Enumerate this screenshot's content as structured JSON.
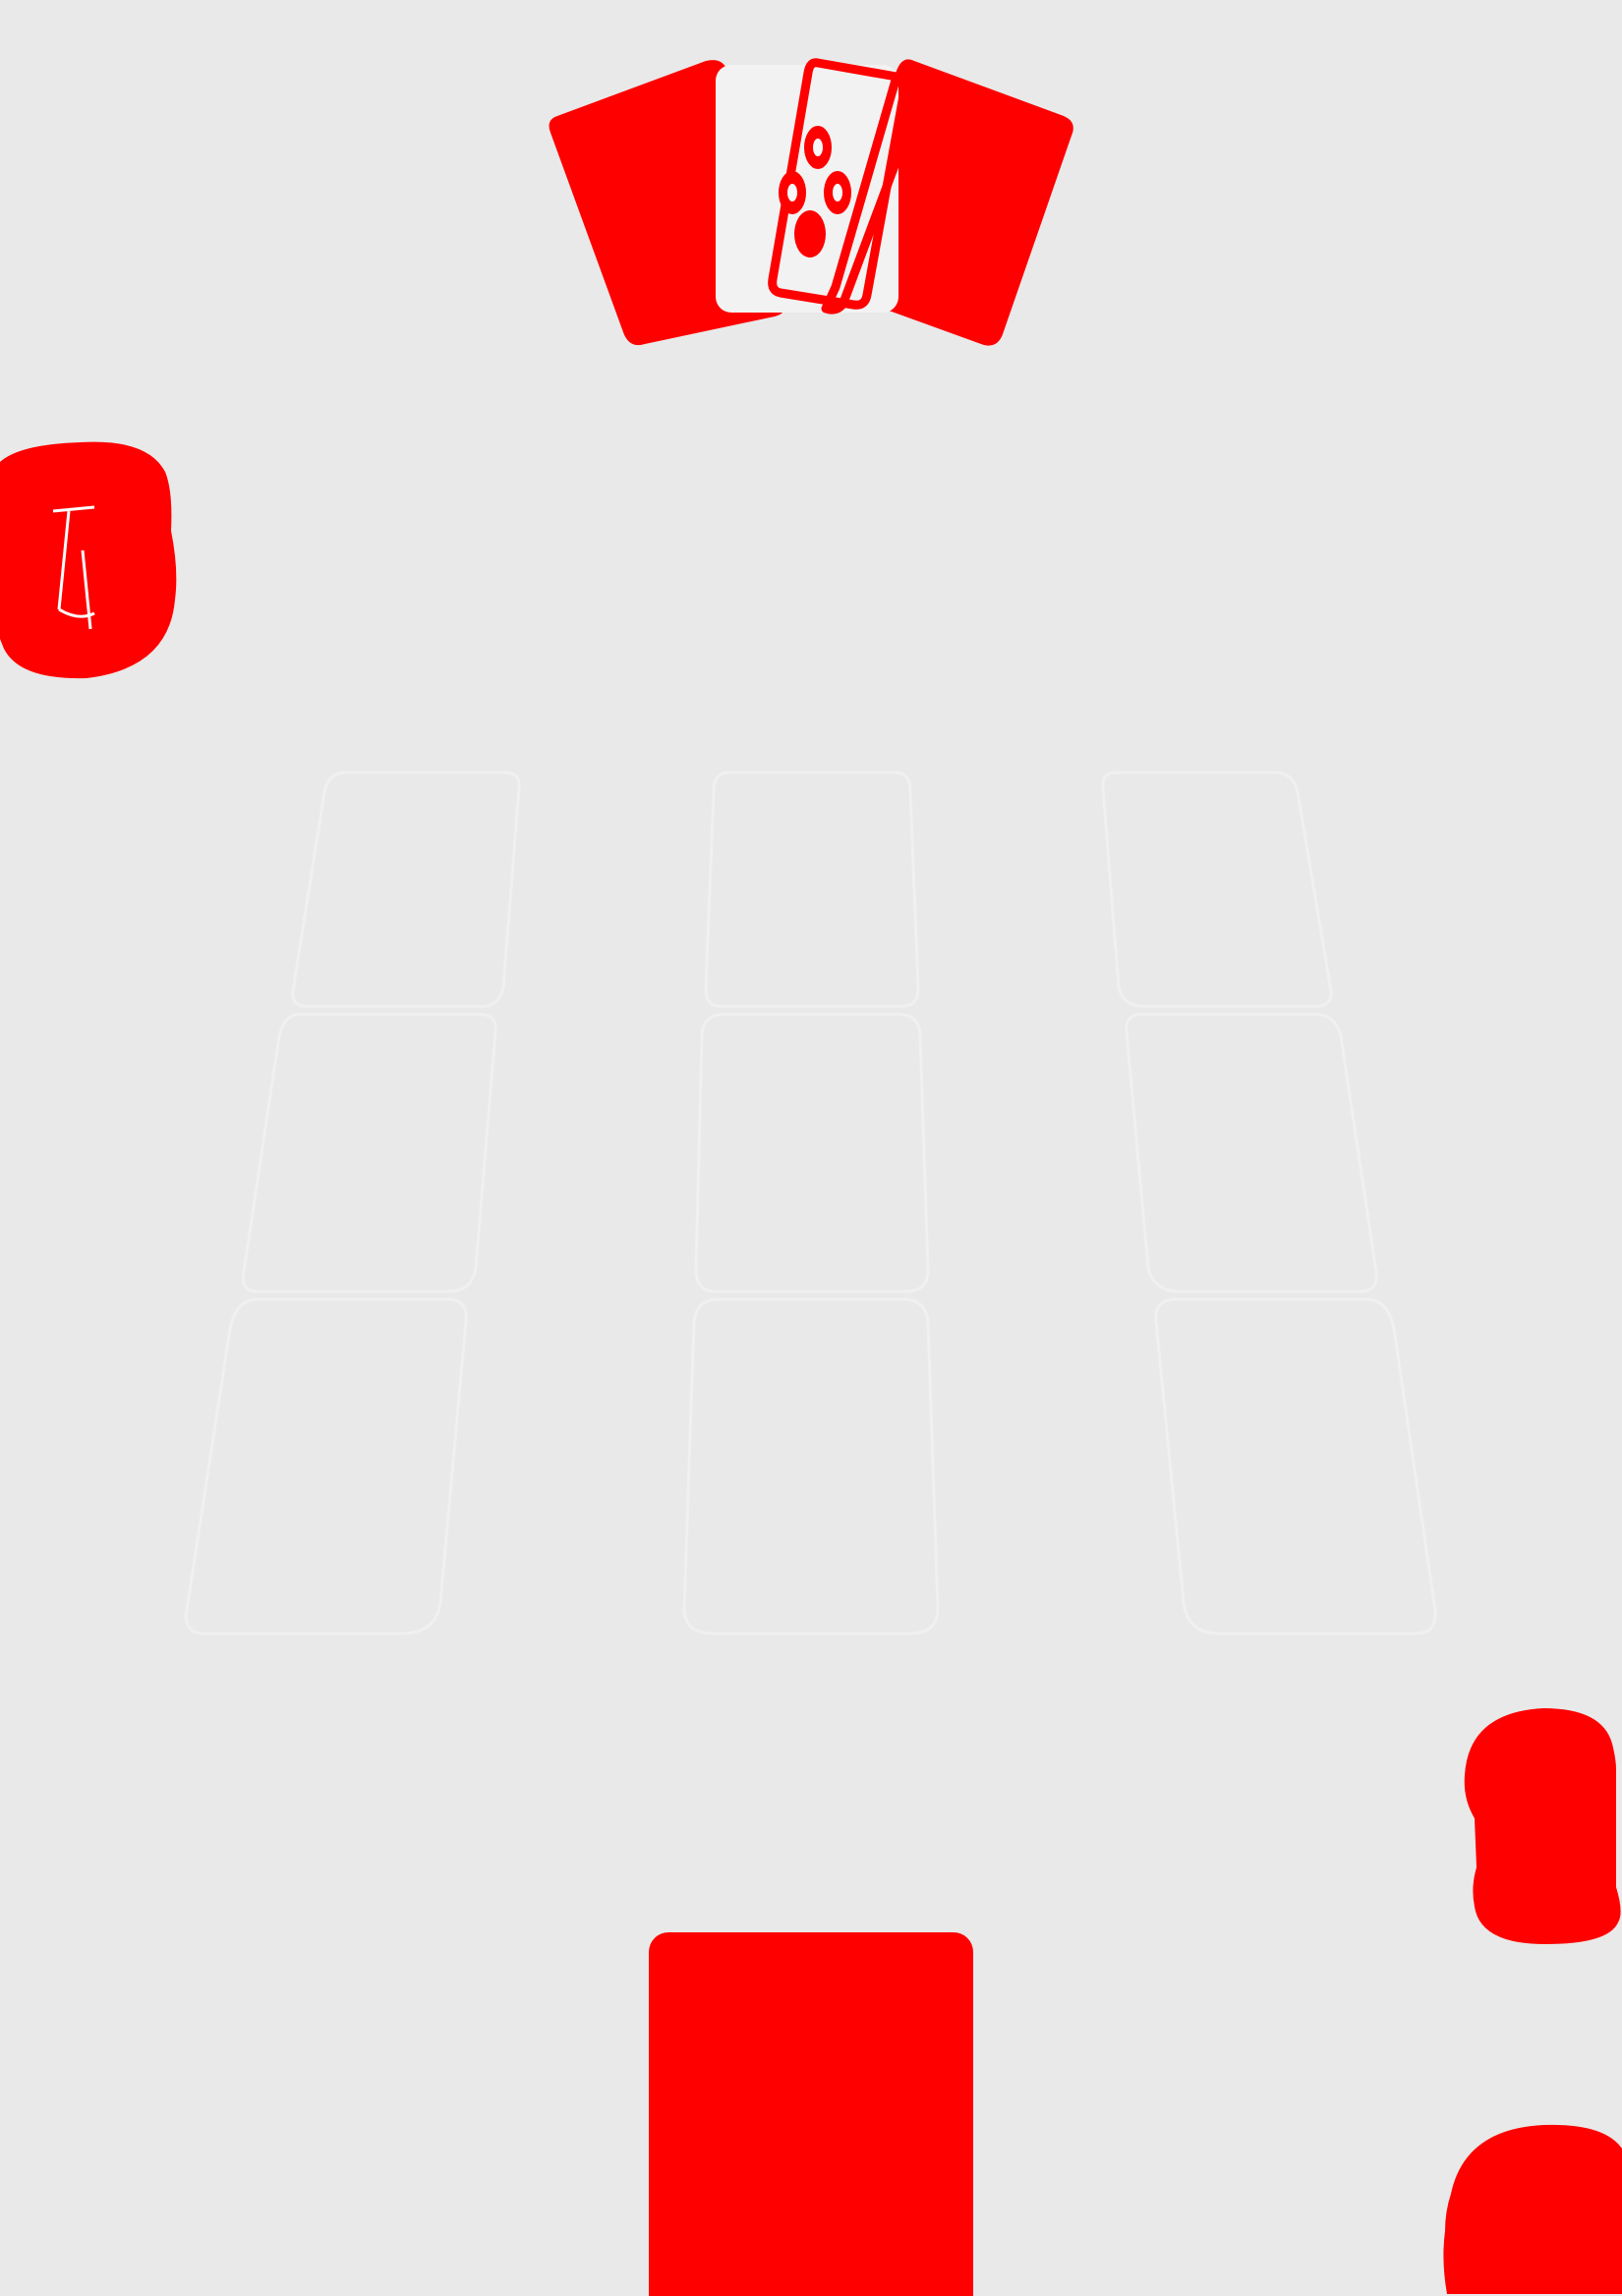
{
  "colors": {
    "background": "#e9e9e9",
    "accent": "#ff0000",
    "slot_outline": "#f0f0f0",
    "card_face": "#f2f2f2"
  },
  "top_hand": {
    "icon": "fanned-cards-icon",
    "card_count": 4
  },
  "left_token": {
    "icon": "token-icon"
  },
  "board": {
    "rows": 3,
    "columns": 3
  },
  "right_tokens": {
    "icons": [
      "token-icon",
      "token-icon"
    ]
  },
  "deck": {
    "icon": "deck-icon"
  }
}
